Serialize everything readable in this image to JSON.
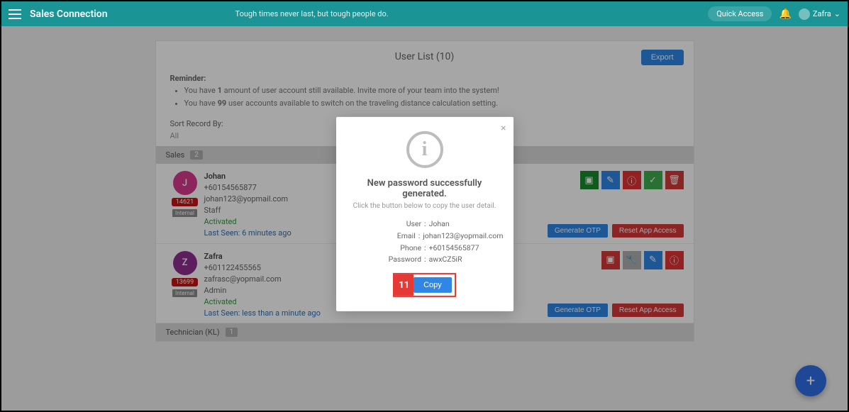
{
  "topbar": {
    "brand": "Sales Connection",
    "quote": "Tough times never last, but tough people do.",
    "quick_access": "Quick Access",
    "username": "Zafra"
  },
  "page": {
    "title": "User List (10)",
    "export": "Export",
    "reminder_title": "Reminder:",
    "reminder_items": [
      "You have 1 amount of user account still available. Invite more of your team into the system!",
      "You have 99 user accounts available to switch on the traveling distance calculation setting."
    ],
    "sort_label": "Sort Record By:",
    "sort_filter": "All"
  },
  "groups": [
    {
      "name": "Sales",
      "count": "2",
      "users": [
        {
          "initial": "J",
          "avatar_class": "bg-pink",
          "name": "Johan",
          "phone": "+60154565877",
          "email": "johan123@yopmail.com",
          "role": "Staff",
          "status": "Activated",
          "last_seen": "Last Seen: 6 minutes ago",
          "id": "14621",
          "internal": "Internal",
          "action_set": "A"
        },
        {
          "initial": "Z",
          "avatar_class": "bg-purple",
          "name": "Zafra",
          "phone": "+601122455565",
          "email": "zafrasc@yopmail.com",
          "role": "Admin",
          "status": "Activated",
          "last_seen": "Last Seen: less than a minute ago",
          "id": "13699",
          "internal": "Internal",
          "action_set": "B"
        }
      ]
    },
    {
      "name": "Technician (KL)",
      "count": "1",
      "users": []
    }
  ],
  "buttons": {
    "generate_otp": "Generate OTP",
    "reset_app": "Reset App Access"
  },
  "modal": {
    "title": "New password successfully generated.",
    "subtitle": "Click the button below to copy the user detail.",
    "fields": {
      "user_label": "User",
      "user_val": "Johan",
      "email_label": "Email",
      "email_val": "johan123@yopmail.com",
      "phone_label": "Phone",
      "phone_val": "+60154565877",
      "password_label": "Password",
      "password_val": "awxCZ5iR"
    },
    "callout_num": "11",
    "copy": "Copy"
  }
}
